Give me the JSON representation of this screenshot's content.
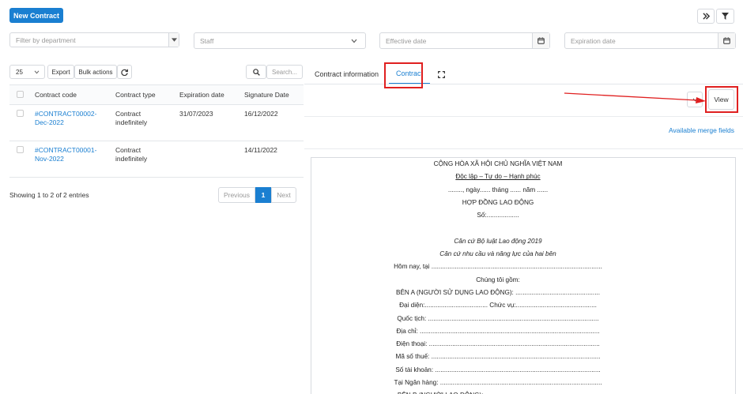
{
  "toolbar": {
    "new_contract": "New Contract",
    "expand_icon": "double-chevron-right-icon",
    "filter_icon": "funnel-icon"
  },
  "filters": {
    "department_placeholder": "Filter by department",
    "staff_placeholder": "Staff",
    "effective_date_placeholder": "Effective date",
    "expiration_date_placeholder": "Expiration date"
  },
  "list_controls": {
    "page_size": "25",
    "export_label": "Export",
    "bulk_actions_label": "Bulk actions",
    "search_placeholder": "Search..."
  },
  "table": {
    "columns": [
      "Contract code",
      "Contract type",
      "Expiration date",
      "Signature Date"
    ],
    "rows": [
      {
        "code_line1": "#CONTRACT00002-",
        "code_line2": "Dec-2022",
        "type_line1": "Contract",
        "type_line2": "indefinitely",
        "expiration": "31/07/2023",
        "signature": "16/12/2022"
      },
      {
        "code_line1": "#CONTRACT00001-",
        "code_line2": "Nov-2022",
        "type_line1": "Contract",
        "type_line2": "indefinitely",
        "expiration": "",
        "signature": "14/11/2022"
      }
    ],
    "summary": "Showing 1 to 2 of 2 entries"
  },
  "pagination": {
    "previous": "Previous",
    "current": "1",
    "next": "Next"
  },
  "tabs": {
    "contract_information": "Contract information",
    "contract": "Contract"
  },
  "view_panel": {
    "view_label": "View",
    "merge_fields_link": "Available merge fields"
  },
  "document": {
    "lines": [
      {
        "text": "CỘNG HÒA XÃ HỘI CHỦ NGHĨA VIỆT NAM",
        "style": ""
      },
      {
        "text": "Độc lập – Tự do – Hạnh phúc",
        "style": "u"
      },
      {
        "text": "........, ngày...... tháng ...... năm ......",
        "style": ""
      },
      {
        "text": "HỢP ĐỒNG LAO ĐỘNG",
        "style": ""
      },
      {
        "text": "Số:..................",
        "style": ""
      },
      {
        "text": "",
        "style": ""
      },
      {
        "text": "Căn cứ Bộ luật Lao động 2019",
        "style": "i"
      },
      {
        "text": "Căn cứ nhu cầu và năng lực của hai bên",
        "style": "i"
      },
      {
        "text": "Hôm nay, tại ...............................................................................................",
        "style": ""
      },
      {
        "text": "Chúng tôi gồm:",
        "style": ""
      },
      {
        "text": "BÊN A (NGƯỜI SỬ DỤNG LAO ĐỘNG): ...............................................",
        "style": ""
      },
      {
        "text": "Đại diện:................................... Chức vụ:.............................................",
        "style": ""
      },
      {
        "text": "Quốc tịch: ...............................................................................................",
        "style": ""
      },
      {
        "text": "Địa chỉ: ....................................................................................................",
        "style": ""
      },
      {
        "text": "Điện thoại: ...............................................................................................",
        "style": ""
      },
      {
        "text": "Mã số thuế: ..............................................................................................",
        "style": ""
      },
      {
        "text": "Số tài khoản: ............................................................................................",
        "style": ""
      },
      {
        "text": "Tại Ngân hàng: ..........................................................................................",
        "style": ""
      },
      {
        "text": "BÊN B (NGƯỜI LAO ĐỘNG): ...............................................................",
        "style": ""
      }
    ]
  }
}
